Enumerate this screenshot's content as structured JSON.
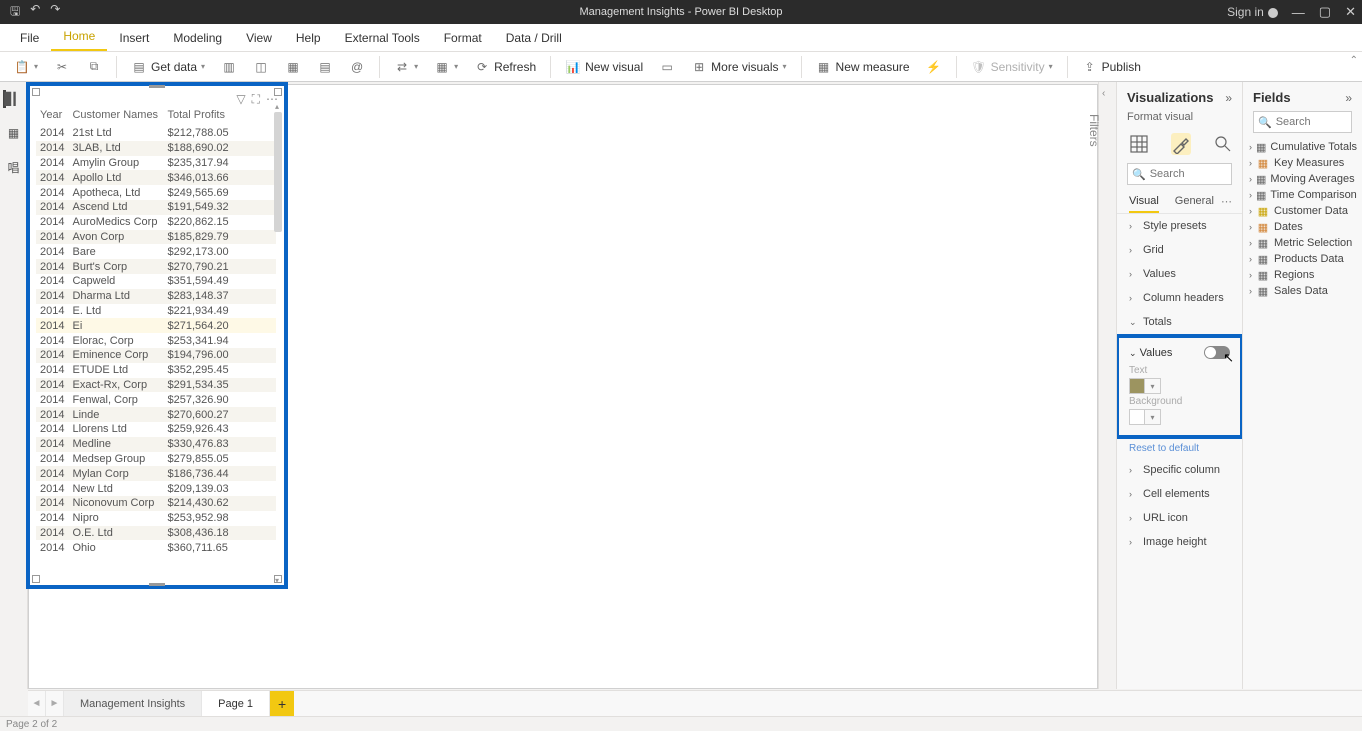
{
  "app": {
    "title": "Management Insights - Power BI Desktop",
    "signin": "Sign in",
    "status": "Page 2 of 2"
  },
  "tabs": {
    "file": "File",
    "home": "Home",
    "insert": "Insert",
    "modeling": "Modeling",
    "view": "View",
    "help": "Help",
    "external": "External Tools",
    "format": "Format",
    "datadrill": "Data / Drill"
  },
  "ribbon": {
    "getdata": "Get data",
    "refresh": "Refresh",
    "newvisual": "New visual",
    "morevisuals": "More visuals",
    "newmeasure": "New measure",
    "sensitivity": "Sensitivity",
    "publish": "Publish"
  },
  "filters_label": "Filters",
  "viz": {
    "title": "Visualizations",
    "format_visual": "Format visual",
    "search_ph": "Search",
    "tab_visual": "Visual",
    "tab_general": "General",
    "items": {
      "style": "Style presets",
      "grid": "Grid",
      "values": "Values",
      "colheaders": "Column headers",
      "totals": "Totals",
      "values2": "Values",
      "text": "Text",
      "background": "Background",
      "reset": "Reset to default",
      "specific": "Specific column",
      "cell": "Cell elements",
      "url": "URL icon",
      "imgh": "Image height"
    }
  },
  "fields": {
    "title": "Fields",
    "search_ph": "Search",
    "items": [
      {
        "name": "Cumulative Totals",
        "icon": "tbl"
      },
      {
        "name": "Key Measures",
        "icon": "cal"
      },
      {
        "name": "Moving Averages",
        "icon": "tbl"
      },
      {
        "name": "Time Comparison",
        "icon": "tbl"
      },
      {
        "name": "Customer Data",
        "icon": "sel"
      },
      {
        "name": "Dates",
        "icon": "cal"
      },
      {
        "name": "Metric Selection",
        "icon": "tbl"
      },
      {
        "name": "Products Data",
        "icon": "tbl"
      },
      {
        "name": "Regions",
        "icon": "tbl"
      },
      {
        "name": "Sales Data",
        "icon": "tbl"
      }
    ]
  },
  "pages": {
    "p1": "Management Insights",
    "p2": "Page 1"
  },
  "table": {
    "headers": {
      "year": "Year",
      "customer": "Customer Names",
      "profits": "Total Profits"
    },
    "rows": [
      {
        "y": "2014",
        "c": "21st Ltd",
        "p": "$212,788.05"
      },
      {
        "y": "2014",
        "c": "3LAB, Ltd",
        "p": "$188,690.02"
      },
      {
        "y": "2014",
        "c": "Amylin Group",
        "p": "$235,317.94"
      },
      {
        "y": "2014",
        "c": "Apollo Ltd",
        "p": "$346,013.66"
      },
      {
        "y": "2014",
        "c": "Apotheca, Ltd",
        "p": "$249,565.69"
      },
      {
        "y": "2014",
        "c": "Ascend Ltd",
        "p": "$191,549.32"
      },
      {
        "y": "2014",
        "c": "AuroMedics Corp",
        "p": "$220,862.15"
      },
      {
        "y": "2014",
        "c": "Avon Corp",
        "p": "$185,829.79"
      },
      {
        "y": "2014",
        "c": "Bare",
        "p": "$292,173.00"
      },
      {
        "y": "2014",
        "c": "Burt's Corp",
        "p": "$270,790.21"
      },
      {
        "y": "2014",
        "c": "Capweld",
        "p": "$351,594.49"
      },
      {
        "y": "2014",
        "c": "Dharma Ltd",
        "p": "$283,148.37"
      },
      {
        "y": "2014",
        "c": "E. Ltd",
        "p": "$221,934.49"
      },
      {
        "y": "2014",
        "c": "Ei",
        "p": "$271,564.20"
      },
      {
        "y": "2014",
        "c": "Elorac, Corp",
        "p": "$253,341.94"
      },
      {
        "y": "2014",
        "c": "Eminence Corp",
        "p": "$194,796.00"
      },
      {
        "y": "2014",
        "c": "ETUDE Ltd",
        "p": "$352,295.45"
      },
      {
        "y": "2014",
        "c": "Exact-Rx, Corp",
        "p": "$291,534.35"
      },
      {
        "y": "2014",
        "c": "Fenwal, Corp",
        "p": "$257,326.90"
      },
      {
        "y": "2014",
        "c": "Linde",
        "p": "$270,600.27"
      },
      {
        "y": "2014",
        "c": "Llorens Ltd",
        "p": "$259,926.43"
      },
      {
        "y": "2014",
        "c": "Medline",
        "p": "$330,476.83"
      },
      {
        "y": "2014",
        "c": "Medsep Group",
        "p": "$279,855.05"
      },
      {
        "y": "2014",
        "c": "Mylan Corp",
        "p": "$186,736.44"
      },
      {
        "y": "2014",
        "c": "New Ltd",
        "p": "$209,139.03"
      },
      {
        "y": "2014",
        "c": "Niconovum Corp",
        "p": "$214,430.62"
      },
      {
        "y": "2014",
        "c": "Nipro",
        "p": "$253,952.98"
      },
      {
        "y": "2014",
        "c": "O.E. Ltd",
        "p": "$308,436.18"
      },
      {
        "y": "2014",
        "c": "Ohio",
        "p": "$360,711.65"
      }
    ]
  }
}
